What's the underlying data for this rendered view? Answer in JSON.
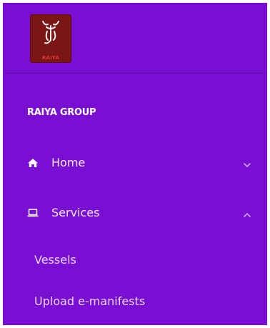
{
  "logo": {
    "text": "RAIYA"
  },
  "sidebar": {
    "group_title": "RAIYA GROUP",
    "items": [
      {
        "label": "Home",
        "icon": "home-icon",
        "chevron": "chevron-down-icon"
      },
      {
        "label": "Services",
        "icon": "laptop-icon",
        "chevron": "chevron-up-icon"
      }
    ],
    "subitems": [
      {
        "label": "Vessels"
      },
      {
        "label": "Upload e-manifests"
      }
    ]
  },
  "colors": {
    "sidebar_bg": "#7a0fd4",
    "logo_bg": "#7a1616",
    "text": "#ffffff"
  }
}
